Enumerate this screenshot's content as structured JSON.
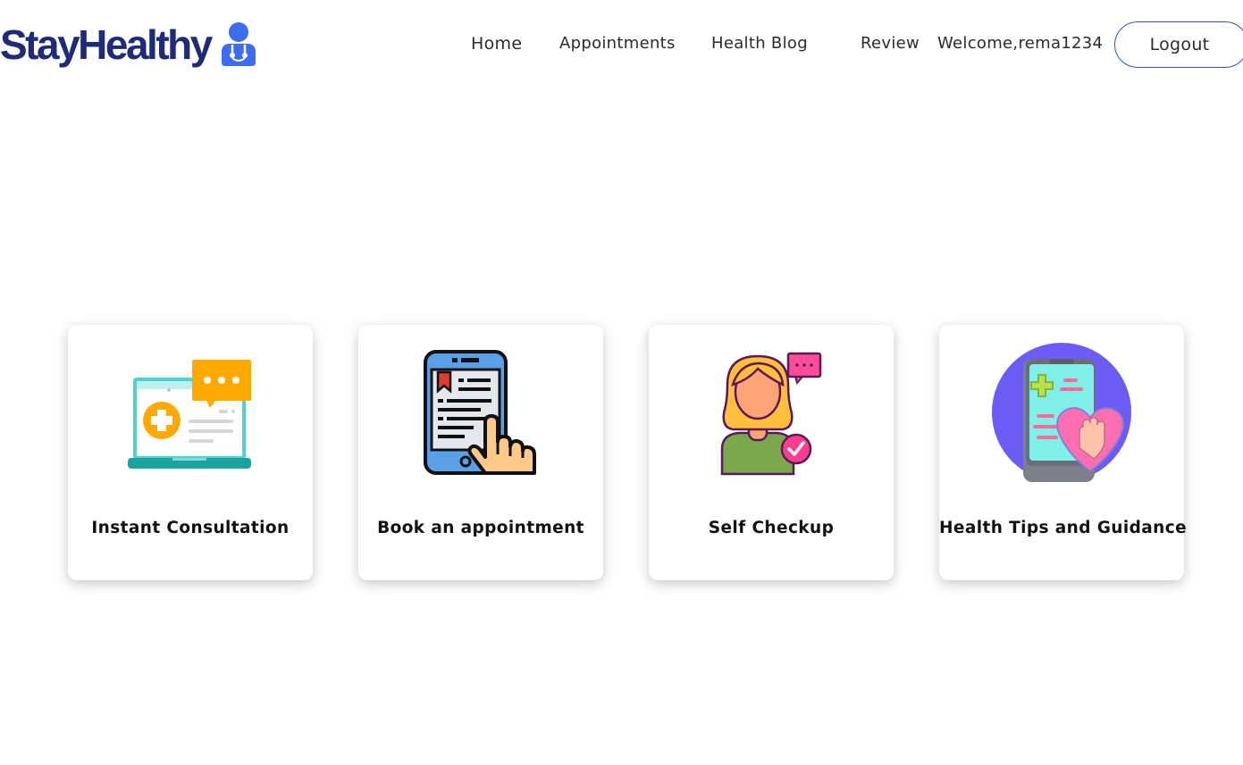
{
  "brand": {
    "name": "StayHealthy",
    "logo_icon": "doctor-icon",
    "color": "#1f2a78",
    "icon_color": "#3d6df0"
  },
  "nav": {
    "home": "Home",
    "appointments": "Appointments",
    "health_blog": "Health Blog",
    "review": "Review",
    "welcome": "Welcome,rema1234",
    "logout": "Logout",
    "logout_border_color": "#3650c4"
  },
  "services": [
    {
      "label": "Instant Consultation",
      "icon": "laptop-medical-chat-icon"
    },
    {
      "label": "Book an appointment",
      "icon": "phone-booking-icon"
    },
    {
      "label": "Self Checkup",
      "icon": "self-checkup-woman-icon"
    },
    {
      "label": "Health Tips and Guidance",
      "icon": "phone-heart-tips-icon"
    }
  ]
}
